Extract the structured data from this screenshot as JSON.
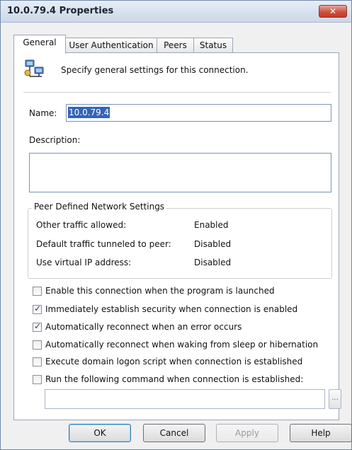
{
  "window": {
    "title": "10.0.79.4 Properties",
    "close_glyph": "✕"
  },
  "tabs": [
    {
      "label": "General",
      "active": true
    },
    {
      "label": "User Authentication",
      "active": false
    },
    {
      "label": "Peers",
      "active": false
    },
    {
      "label": "Status",
      "active": false
    }
  ],
  "header": {
    "icon": "network-connection-icon",
    "text": "Specify general settings for this connection."
  },
  "fields": {
    "name_label": "Name:",
    "name_value": "10.0.79.4",
    "description_label": "Description:",
    "description_value": ""
  },
  "peer_settings": {
    "title": "Peer Defined Network Settings",
    "rows": [
      {
        "label": "Other traffic allowed:",
        "value": "Enabled"
      },
      {
        "label": "Default traffic tunneled to peer:",
        "value": "Disabled"
      },
      {
        "label": "Use virtual IP address:",
        "value": "Disabled"
      }
    ]
  },
  "options": [
    {
      "label": "Enable this connection when the program is launched",
      "checked": false
    },
    {
      "label": "Immediately establish security when connection is enabled",
      "checked": true
    },
    {
      "label": "Automatically reconnect when an error occurs",
      "checked": true
    },
    {
      "label": "Automatically reconnect when waking from sleep or hibernation",
      "checked": false
    },
    {
      "label": "Execute domain logon script when connection is established",
      "checked": false
    },
    {
      "label": "Run the following command when connection is established:",
      "checked": false
    }
  ],
  "command": {
    "value": "",
    "browse_label": "..."
  },
  "buttons": {
    "ok": "OK",
    "cancel": "Cancel",
    "apply": "Apply",
    "help": "Help"
  },
  "colors": {
    "selection": "#3465b5",
    "title_bar": "#d7e1ee",
    "close_button": "#cf4b38"
  }
}
